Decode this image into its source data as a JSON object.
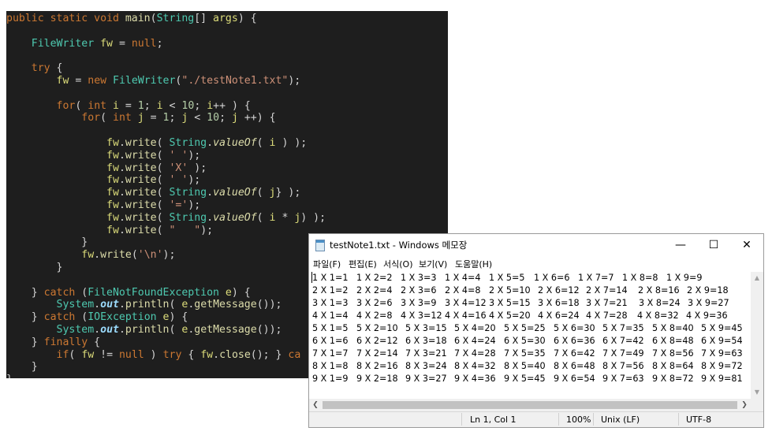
{
  "code_editor": {
    "lines": [
      [
        [
          "k",
          "public static void "
        ],
        [
          "f",
          "main"
        ],
        [
          "pl",
          "("
        ],
        [
          "t",
          "String"
        ],
        [
          "pl",
          "[] "
        ],
        [
          "v",
          "args"
        ],
        [
          "pl",
          ") {"
        ]
      ],
      [],
      [
        [
          "pl",
          "    "
        ],
        [
          "t",
          "FileWriter "
        ],
        [
          "v",
          "fw"
        ],
        [
          "pl",
          " = "
        ],
        [
          "k",
          "null"
        ],
        [
          "pl",
          ";"
        ]
      ],
      [],
      [
        [
          "pl",
          "    "
        ],
        [
          "k",
          "try"
        ],
        [
          "pl",
          " {"
        ]
      ],
      [
        [
          "pl",
          "        "
        ],
        [
          "v",
          "fw"
        ],
        [
          "pl",
          " = "
        ],
        [
          "k",
          "new "
        ],
        [
          "t",
          "FileWriter"
        ],
        [
          "pl",
          "("
        ],
        [
          "s",
          "\"./testNote1.txt\""
        ],
        [
          "pl",
          ");"
        ]
      ],
      [],
      [
        [
          "pl",
          "        "
        ],
        [
          "k",
          "for"
        ],
        [
          "pl",
          "( "
        ],
        [
          "k",
          "int "
        ],
        [
          "v",
          "i"
        ],
        [
          "pl",
          " = "
        ],
        [
          "n",
          "1"
        ],
        [
          "pl",
          "; "
        ],
        [
          "v",
          "i"
        ],
        [
          "pl",
          " < "
        ],
        [
          "n",
          "10"
        ],
        [
          "pl",
          "; "
        ],
        [
          "v",
          "i"
        ],
        [
          "pl",
          "++ ) {"
        ]
      ],
      [
        [
          "pl",
          "            "
        ],
        [
          "k",
          "for"
        ],
        [
          "pl",
          "( "
        ],
        [
          "k",
          "int "
        ],
        [
          "v",
          "j"
        ],
        [
          "pl",
          " = "
        ],
        [
          "n",
          "1"
        ],
        [
          "pl",
          "; "
        ],
        [
          "v",
          "j"
        ],
        [
          "pl",
          " < "
        ],
        [
          "n",
          "10"
        ],
        [
          "pl",
          "; "
        ],
        [
          "v",
          "j"
        ],
        [
          "pl",
          " ++) {"
        ]
      ],
      [],
      [
        [
          "pl",
          "                "
        ],
        [
          "v",
          "fw"
        ],
        [
          "pl",
          "."
        ],
        [
          "f",
          "write"
        ],
        [
          "pl",
          "( "
        ],
        [
          "t",
          "String"
        ],
        [
          "pl",
          "."
        ],
        [
          "i",
          "valueOf"
        ],
        [
          "pl",
          "( "
        ],
        [
          "v",
          "i"
        ],
        [
          "pl",
          " ) );"
        ]
      ],
      [
        [
          "pl",
          "                "
        ],
        [
          "v",
          "fw"
        ],
        [
          "pl",
          "."
        ],
        [
          "f",
          "write"
        ],
        [
          "pl",
          "( "
        ],
        [
          "s",
          "' '"
        ],
        [
          "pl",
          ");"
        ]
      ],
      [
        [
          "pl",
          "                "
        ],
        [
          "v",
          "fw"
        ],
        [
          "pl",
          "."
        ],
        [
          "f",
          "write"
        ],
        [
          "pl",
          "( "
        ],
        [
          "s",
          "'X'"
        ],
        [
          "pl",
          " );"
        ]
      ],
      [
        [
          "pl",
          "                "
        ],
        [
          "v",
          "fw"
        ],
        [
          "pl",
          "."
        ],
        [
          "f",
          "write"
        ],
        [
          "pl",
          "( "
        ],
        [
          "s",
          "' '"
        ],
        [
          "pl",
          ");"
        ]
      ],
      [
        [
          "pl",
          "                "
        ],
        [
          "v",
          "fw"
        ],
        [
          "pl",
          "."
        ],
        [
          "f",
          "write"
        ],
        [
          "pl",
          "( "
        ],
        [
          "t",
          "String"
        ],
        [
          "pl",
          "."
        ],
        [
          "i",
          "valueOf"
        ],
        [
          "pl",
          "( "
        ],
        [
          "v",
          "j"
        ],
        [
          "pl",
          "} );"
        ]
      ],
      [
        [
          "pl",
          "                "
        ],
        [
          "v",
          "fw"
        ],
        [
          "pl",
          "."
        ],
        [
          "f",
          "write"
        ],
        [
          "pl",
          "( "
        ],
        [
          "s",
          "'='"
        ],
        [
          "pl",
          ");"
        ]
      ],
      [
        [
          "pl",
          "                "
        ],
        [
          "v",
          "fw"
        ],
        [
          "pl",
          "."
        ],
        [
          "f",
          "write"
        ],
        [
          "pl",
          "( "
        ],
        [
          "t",
          "String"
        ],
        [
          "pl",
          "."
        ],
        [
          "i",
          "valueOf"
        ],
        [
          "pl",
          "( "
        ],
        [
          "v",
          "i"
        ],
        [
          "pl",
          " * "
        ],
        [
          "v",
          "j"
        ],
        [
          "pl",
          ") );"
        ]
      ],
      [
        [
          "pl",
          "                "
        ],
        [
          "v",
          "fw"
        ],
        [
          "pl",
          "."
        ],
        [
          "f",
          "write"
        ],
        [
          "pl",
          "( "
        ],
        [
          "s",
          "\"   \""
        ],
        [
          "pl",
          ");"
        ]
      ],
      [
        [
          "pl",
          "            }"
        ]
      ],
      [
        [
          "pl",
          "            "
        ],
        [
          "v",
          "fw"
        ],
        [
          "pl",
          "."
        ],
        [
          "f",
          "write"
        ],
        [
          "pl",
          "("
        ],
        [
          "s",
          "'\\n'"
        ],
        [
          "pl",
          ");"
        ]
      ],
      [
        [
          "pl",
          "        }"
        ]
      ],
      [],
      [
        [
          "pl",
          "    } "
        ],
        [
          "k",
          "catch"
        ],
        [
          "pl",
          " ("
        ],
        [
          "t",
          "FileNotFoundException "
        ],
        [
          "v",
          "e"
        ],
        [
          "pl",
          ") {"
        ]
      ],
      [
        [
          "pl",
          "        "
        ],
        [
          "t",
          "System"
        ],
        [
          "pl",
          "."
        ],
        [
          "si",
          "out"
        ],
        [
          "pl",
          "."
        ],
        [
          "f",
          "println"
        ],
        [
          "pl",
          "( "
        ],
        [
          "v",
          "e"
        ],
        [
          "pl",
          "."
        ],
        [
          "f",
          "getMessage"
        ],
        [
          "pl",
          "());"
        ]
      ],
      [
        [
          "pl",
          "    } "
        ],
        [
          "k",
          "catch"
        ],
        [
          "pl",
          " ("
        ],
        [
          "t",
          "IOException "
        ],
        [
          "v",
          "e"
        ],
        [
          "pl",
          ") {"
        ]
      ],
      [
        [
          "pl",
          "        "
        ],
        [
          "t",
          "System"
        ],
        [
          "pl",
          "."
        ],
        [
          "si",
          "out"
        ],
        [
          "pl",
          "."
        ],
        [
          "f",
          "println"
        ],
        [
          "pl",
          "( "
        ],
        [
          "v",
          "e"
        ],
        [
          "pl",
          "."
        ],
        [
          "f",
          "getMessage"
        ],
        [
          "pl",
          "());"
        ]
      ],
      [
        [
          "pl",
          "    } "
        ],
        [
          "k",
          "finally"
        ],
        [
          "pl",
          " {"
        ]
      ],
      [
        [
          "pl",
          "        "
        ],
        [
          "k",
          "if"
        ],
        [
          "pl",
          "( "
        ],
        [
          "v",
          "fw"
        ],
        [
          "pl",
          " != "
        ],
        [
          "k",
          "null"
        ],
        [
          "pl",
          " ) "
        ],
        [
          "k",
          "try"
        ],
        [
          "pl",
          " { "
        ],
        [
          "v",
          "fw"
        ],
        [
          "pl",
          "."
        ],
        [
          "f",
          "close"
        ],
        [
          "pl",
          "(); } "
        ],
        [
          "k",
          "ca"
        ]
      ],
      [
        [
          "pl",
          "    }"
        ]
      ],
      [
        [
          "pl",
          "}"
        ]
      ]
    ]
  },
  "notepad": {
    "title": "testNote1.txt - Windows 메모장",
    "minimize": "—",
    "maximize": "☐",
    "close": "✕",
    "menu": [
      "파일(F)",
      "편집(E)",
      "서식(O)",
      "보기(V)",
      "도움말(H)"
    ],
    "text_lines": [
      [
        "1 X 1=1",
        "1 X 2=2",
        "1 X 3=3",
        "1 X 4=4",
        "1 X 5=5",
        "1 X 6=6",
        "1 X 7=7",
        "1 X 8=8",
        "1 X 9=9"
      ],
      [
        "2 X 1=2",
        "2 X 2=4",
        "2 X 3=6",
        "2 X 4=8",
        "2 X 5=10",
        "2 X 6=12",
        "2 X 7=14",
        "2 X 8=16",
        "2 X 9=18"
      ],
      [
        "3 X 1=3",
        "3 X 2=6",
        "3 X 3=9",
        "3 X 4=12",
        "3 X 5=15",
        "3 X 6=18",
        "3 X 7=21",
        "3 X 8=24",
        "3 X 9=27"
      ],
      [
        "4 X 1=4",
        "4 X 2=8",
        "4 X 3=12",
        "4 X 4=16",
        "4 X 5=20",
        "4 X 6=24",
        "4 X 7=28",
        "4 X 8=32",
        "4 X 9=36"
      ],
      [
        "5 X 1=5",
        "5 X 2=10",
        "5 X 3=15",
        "5 X 4=20",
        "5 X 5=25",
        "5 X 6=30",
        "5 X 7=35",
        "5 X 8=40",
        "5 X 9=45"
      ],
      [
        "6 X 1=6",
        "6 X 2=12",
        "6 X 3=18",
        "6 X 4=24",
        "6 X 5=30",
        "6 X 6=36",
        "6 X 7=42",
        "6 X 8=48",
        "6 X 9=54"
      ],
      [
        "7 X 1=7",
        "7 X 2=14",
        "7 X 3=21",
        "7 X 4=28",
        "7 X 5=35",
        "7 X 6=42",
        "7 X 7=49",
        "7 X 8=56",
        "7 X 9=63"
      ],
      [
        "8 X 1=8",
        "8 X 2=16",
        "8 X 3=24",
        "8 X 4=32",
        "8 X 5=40",
        "8 X 6=48",
        "8 X 7=56",
        "8 X 8=64",
        "8 X 9=72"
      ],
      [
        "9 X 1=9",
        "9 X 2=18",
        "9 X 3=27",
        "9 X 4=36",
        "9 X 5=45",
        "9 X 6=54",
        "9 X 7=63",
        "9 X 8=72",
        "9 X 9=81"
      ]
    ],
    "status": {
      "position": "Ln 1, Col 1",
      "zoom": "100%",
      "line_ending": "Unix (LF)",
      "encoding": "UTF-8"
    }
  }
}
